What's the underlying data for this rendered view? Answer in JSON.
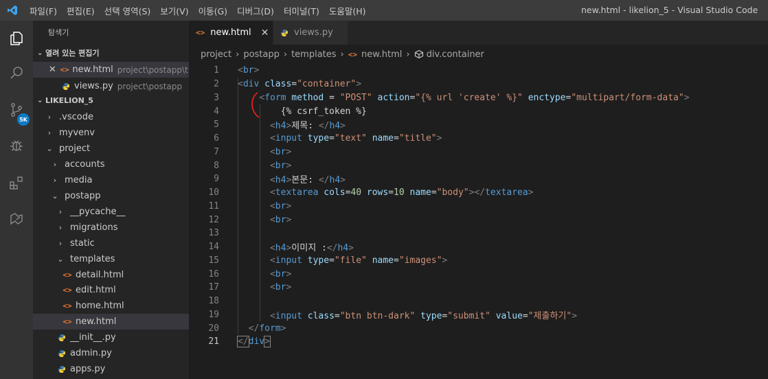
{
  "window": {
    "title": "new.html - likelion_5 - Visual Studio Code",
    "menu": [
      "파일(F)",
      "편집(E)",
      "선택 영역(S)",
      "보기(V)",
      "이동(G)",
      "디버그(D)",
      "터미널(T)",
      "도움말(H)"
    ]
  },
  "activity": {
    "items": [
      "explorer-icon",
      "search-icon",
      "source-control-icon",
      "debug-icon",
      "extensions-icon",
      "live-share-icon"
    ],
    "badge": "5K",
    "accent": "#0e7ac6"
  },
  "sidebar": {
    "title": "탐색기",
    "open_editors_header": "열려 있는 편집기",
    "open_editors": [
      {
        "name": "new.html",
        "hint": "project\\postapp\\t..."
      },
      {
        "name": "views.py",
        "hint": "project\\postapp"
      }
    ],
    "workspace_header": "LIKELION_5",
    "tree": [
      ".vscode",
      "myvenv",
      "project",
      "accounts",
      "media",
      "postapp",
      "__pycache__",
      "migrations",
      "static",
      "templates",
      "detail.html",
      "edit.html",
      "home.html",
      "new.html",
      "__init__.py",
      "admin.py",
      "apps.py"
    ]
  },
  "tabs": [
    {
      "label": "new.html",
      "close": "✕"
    },
    {
      "label": "views.py"
    }
  ],
  "breadcrumb": [
    "project",
    "postapp",
    "templates",
    "new.html",
    "div.container"
  ],
  "editor": {
    "line_numbers": [
      "1",
      "2",
      "3",
      "4",
      "5",
      "6",
      "7",
      "8",
      "9",
      "10",
      "11",
      "12",
      "13",
      "14",
      "15",
      "16",
      "17",
      "18",
      "19",
      "20",
      "21"
    ],
    "lines": [
      "<br>",
      "<div class=\"container\">",
      "    <form method = \"POST\" action=\"{% url 'create' %}\" enctype=\"multipart/form-data\">",
      "        {% csrf_token %}",
      "      <h4>제목: </h4>",
      "      <input type=\"text\" name=\"title\">",
      "      <br>",
      "      <br>",
      "      <h4>본문: </h4>",
      "      <textarea cols=40 rows=10 name=\"body\"></textarea>",
      "      <br>",
      "      <br>",
      "",
      "      <h4>이미지 :</h4>",
      "      <input type=\"file\" name=\"images\">",
      "      <br>",
      "      <br>",
      "",
      "      <input class=\"btn btn-dark\" type=\"submit\" value=\"제출하기\">",
      "  </form>",
      "</div>"
    ]
  }
}
